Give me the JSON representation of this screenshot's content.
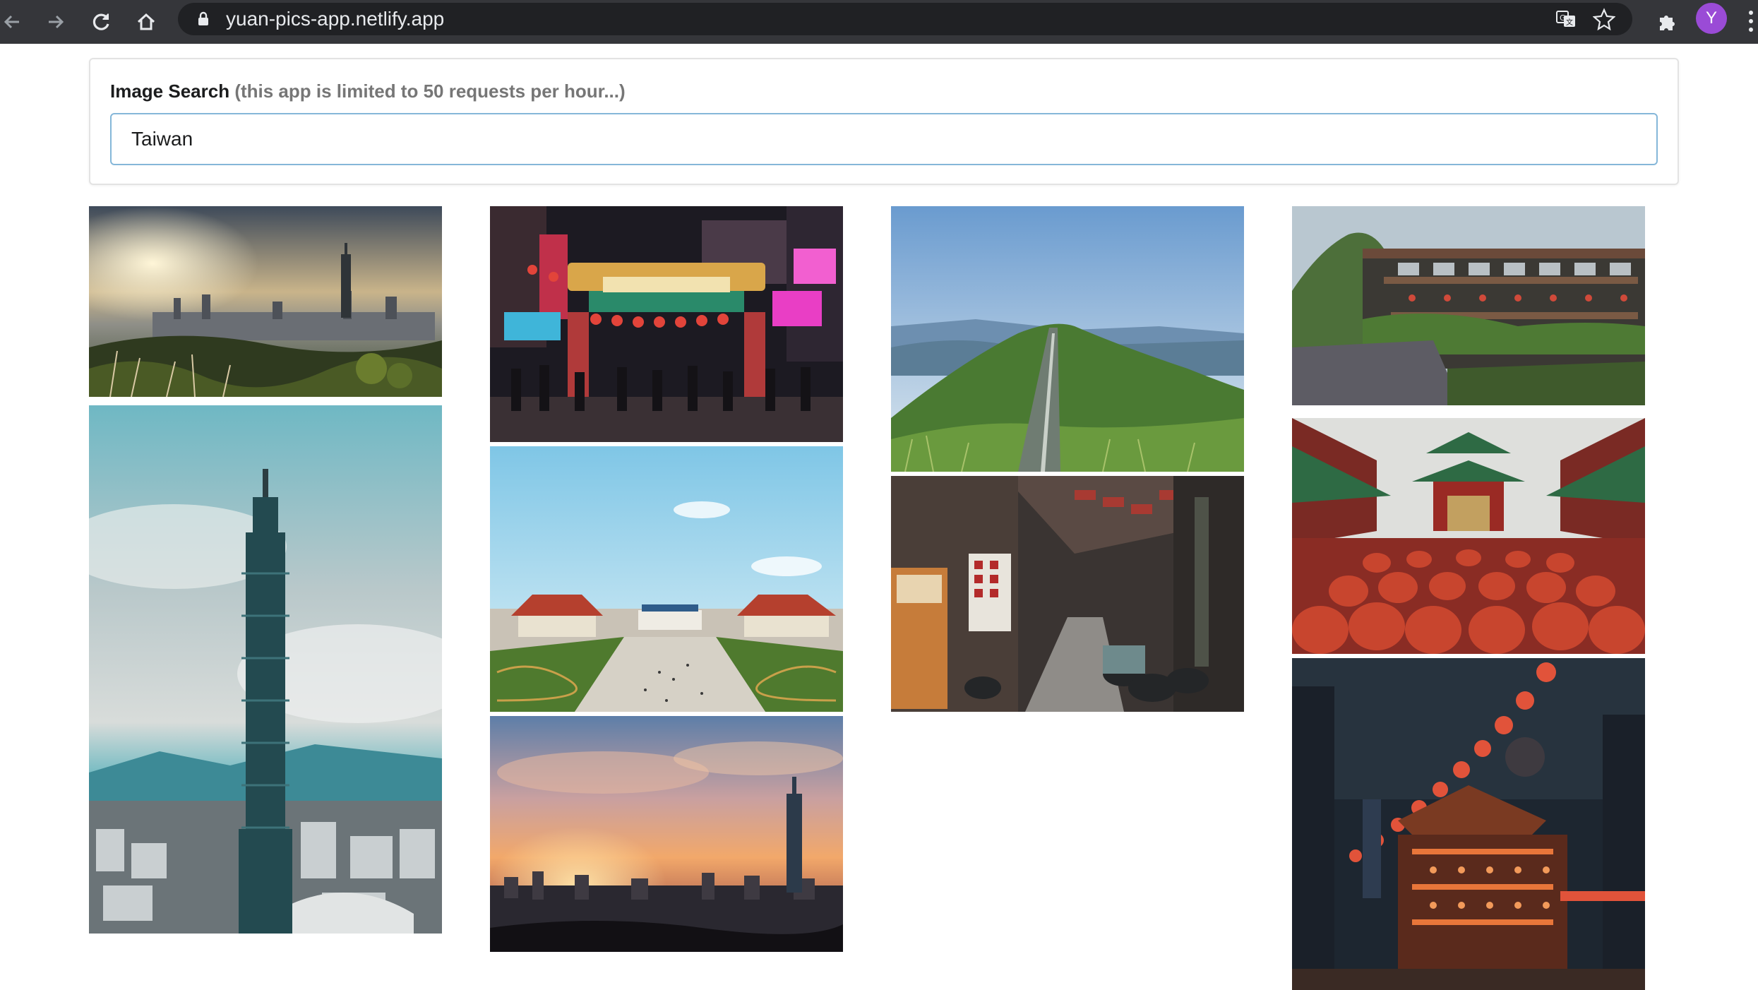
{
  "browser": {
    "url": "yuan-pics-app.netlify.app",
    "profile_initial": "Y",
    "profile_color": "#9a4bd6"
  },
  "search": {
    "label": "Image Search",
    "note": "(this app is limited to 50 requests per hour...)",
    "value": "Taiwan",
    "border_color": "#85b7d9"
  },
  "images": [
    {
      "id": "img-1",
      "subject": "Taipei skyline at dusk with Taipei 101"
    },
    {
      "id": "img-2",
      "subject": "Taipei 101 tower against cloudy sky"
    },
    {
      "id": "img-3",
      "subject": "Night market gate with neon lights"
    },
    {
      "id": "img-4",
      "subject": "Chiang Kai-shek Memorial Hall plaza"
    },
    {
      "id": "img-5",
      "subject": "Sunset over Taipei with Taipei 101"
    },
    {
      "id": "img-6",
      "subject": "Green mountain ridge with road"
    },
    {
      "id": "img-7",
      "subject": "Street with shop signs and scooters"
    },
    {
      "id": "img-8",
      "subject": "Jiufen teahouses on hillside"
    },
    {
      "id": "img-9",
      "subject": "Temple courtyard with red lanterns"
    },
    {
      "id": "img-10",
      "subject": "Temple street at night with red lanterns"
    }
  ]
}
